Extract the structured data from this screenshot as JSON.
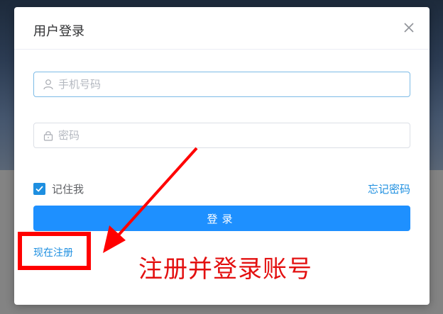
{
  "dialog": {
    "title": "用户登录",
    "close_icon": "close-icon"
  },
  "form": {
    "phone": {
      "placeholder": "手机号码",
      "value": "",
      "icon": "user-icon"
    },
    "password": {
      "placeholder": "密码",
      "value": "",
      "icon": "lock-icon"
    },
    "remember_label": "记住我",
    "remember_checked": true,
    "forgot_label": "忘记密码",
    "login_label": "登录",
    "register_label": "现在注册"
  },
  "annotation": {
    "text": "注册并登录账号",
    "color": "#e31010"
  },
  "colors": {
    "primary": "#1e90ff",
    "link": "#1e8fe0",
    "highlight": "#ff0000"
  }
}
